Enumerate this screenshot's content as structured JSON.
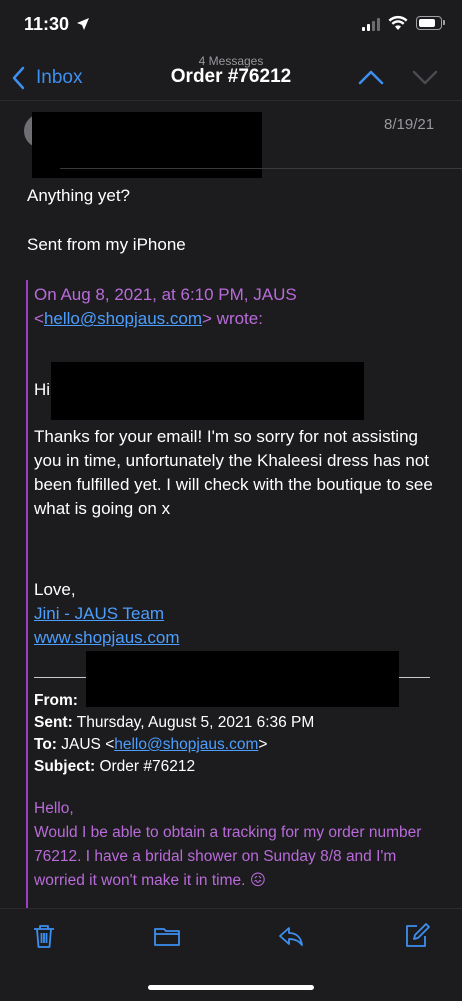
{
  "status_bar": {
    "time": "11:30"
  },
  "nav": {
    "back_label": "Inbox",
    "message_count": "4 Messages",
    "title": "Order #76212"
  },
  "message": {
    "date": "8/19/21",
    "body_line1": "Anything yet?",
    "body_line2": "Sent from my iPhone"
  },
  "quoted": {
    "attribution_line1": "On Aug 8, 2021, at 6:10 PM, JAUS",
    "attribution_lt": "<",
    "attribution_email": "hello@shopjaus.com",
    "attribution_rest": "> wrote:",
    "greeting": "Hi",
    "paragraph": "Thanks for your email! I'm so sorry for not assisting you in time, unfortunately the Khaleesi dress has not been fulfilled yet. I will check with the boutique to see what is going on x",
    "signoff": "Love,",
    "sig_name": "Jini - JAUS Team",
    "sig_url": "www.shopjaus.com"
  },
  "forwarded": {
    "from_label": "From:",
    "sent_label": "Sent:",
    "sent_value": "Thursday, August 5, 2021 6:36 PM",
    "to_label": "To:",
    "to_name": "JAUS <",
    "to_email": "hello@shopjaus.com",
    "to_close": ">",
    "subject_label": "Subject:",
    "subject_value": "Order #76212",
    "hello": "Hello,",
    "body": "Would I be able to obtain a tracking for my order number 76212. I have a bridal shower on Sunday 8/8 and I'm worried it won't make it in time.",
    "emoji": "😖"
  },
  "toolbar": {
    "icons": [
      "trash-icon",
      "folder-icon",
      "reply-icon",
      "compose-icon"
    ]
  },
  "colors": {
    "accent": "#3d8ff0",
    "quote_purple": "#b86bd9",
    "background": "#1c1c1e"
  }
}
